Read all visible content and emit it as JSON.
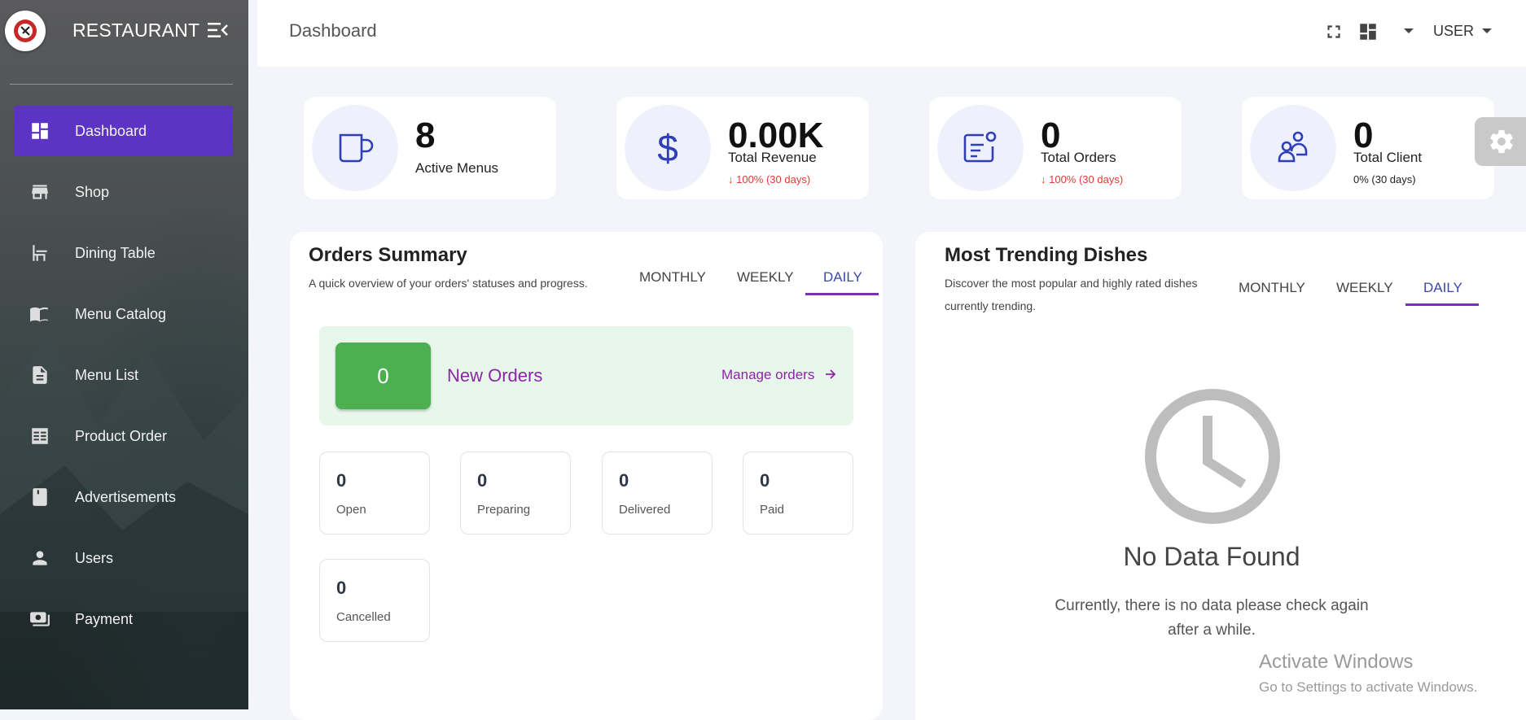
{
  "sidebar": {
    "brand": "RESTAURANT",
    "items": [
      {
        "label": "Dashboard",
        "icon": "dashboard-icon",
        "active": true
      },
      {
        "label": "Shop",
        "icon": "shop-icon"
      },
      {
        "label": "Dining Table",
        "icon": "dining-table-icon"
      },
      {
        "label": "Menu Catalog",
        "icon": "menu-book-icon"
      },
      {
        "label": "Menu List",
        "icon": "document-icon"
      },
      {
        "label": "Product Order",
        "icon": "list-icon"
      },
      {
        "label": "Advertisements",
        "icon": "bookmark-icon"
      },
      {
        "label": "Users",
        "icon": "user-icon"
      },
      {
        "label": "Payment",
        "icon": "payment-icon"
      }
    ]
  },
  "header": {
    "title": "Dashboard",
    "user_label": "USER"
  },
  "stats": [
    {
      "value": "8",
      "label": "Active Menus",
      "change": "",
      "icon": "cup-icon"
    },
    {
      "value": "0.00K",
      "label": "Total Revenue",
      "change": "↓ 100% (30 days)",
      "icon": "dollar-icon"
    },
    {
      "value": "0",
      "label": "Total Orders",
      "change": "↓ 100% (30 days)",
      "icon": "order-card-icon"
    },
    {
      "value": "0",
      "label": "Total Client",
      "change": "0% (30 days)",
      "icon": "clients-icon"
    }
  ],
  "orders_summary": {
    "title": "Orders Summary",
    "subtitle": "A quick overview of your orders' statuses and progress.",
    "tabs": [
      "MONTHLY",
      "WEEKLY",
      "DAILY"
    ],
    "active_tab": "DAILY",
    "new_orders": {
      "count": "0",
      "label": "New Orders",
      "link": "Manage orders"
    },
    "statuses": [
      {
        "value": "0",
        "label": "Open"
      },
      {
        "value": "0",
        "label": "Preparing"
      },
      {
        "value": "0",
        "label": "Delivered"
      },
      {
        "value": "0",
        "label": "Paid"
      },
      {
        "value": "0",
        "label": "Cancelled"
      }
    ]
  },
  "trending": {
    "title": "Most Trending Dishes",
    "subtitle_line1": "Discover the most popular and highly rated dishes",
    "subtitle_line2": "currently trending.",
    "tabs": [
      "MONTHLY",
      "WEEKLY",
      "DAILY"
    ],
    "active_tab": "DAILY",
    "empty_title": "No Data Found",
    "empty_line1": "Currently, there is no data please check again",
    "empty_line2": "after a while."
  },
  "watermark": {
    "line1": "Activate Windows",
    "line2": "Go to Settings to activate Windows."
  },
  "colors": {
    "accent": "#5b34c4",
    "tab_active": "#3949ab",
    "tab_underline": "#7b2fb5",
    "new_orders_bg": "#e8f7ec",
    "new_count": "#4caf50",
    "negative": "#e53935",
    "icon_blue": "#2f3fb8"
  }
}
